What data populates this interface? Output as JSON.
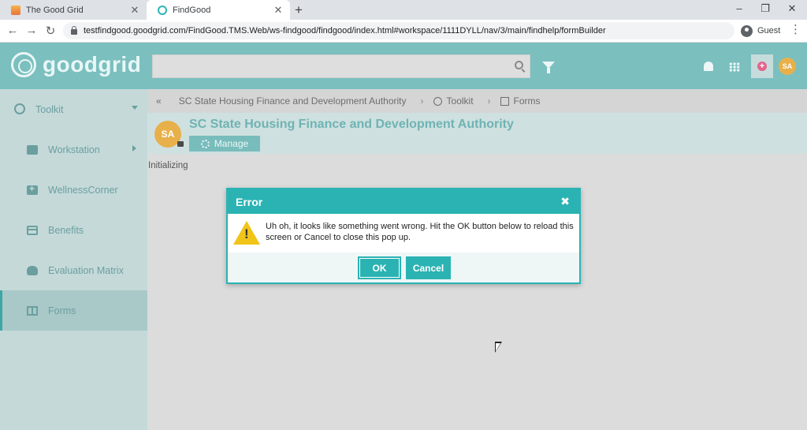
{
  "browser": {
    "tabs": [
      {
        "title": "The Good Grid",
        "active": false
      },
      {
        "title": "FindGood",
        "active": true
      }
    ],
    "new_tab": "+",
    "url": "testfindgood.goodgrid.com/FindGood.TMS.Web/ws-findgood/findgood/index.html#workspace/1111DYLL/nav/3/main/findhelp/formBuilder",
    "profile": "Guest",
    "controls": {
      "minimize": "–",
      "restore": "❐",
      "close": "✕",
      "back": "←",
      "forward": "→",
      "reload": "↻",
      "menu": "⋮"
    }
  },
  "header": {
    "logo_text": "goodgrid",
    "search_placeholder": "",
    "user_initials": "SA",
    "plus_symbol": "+"
  },
  "sidebar": {
    "items": [
      {
        "label": "Toolkit",
        "icon": "globe-icon",
        "arrow": "down"
      },
      {
        "label": "Workstation",
        "icon": "briefcase-icon",
        "arrow": "right"
      },
      {
        "label": "WellnessCorner",
        "icon": "medkit-icon"
      },
      {
        "label": "Benefits",
        "icon": "credit-card-icon"
      },
      {
        "label": "Evaluation Matrix",
        "icon": "cloud-upload-icon"
      },
      {
        "label": "Forms",
        "icon": "columns-icon",
        "active": true
      }
    ]
  },
  "breadcrumb": {
    "collapse": "«",
    "items": [
      "SC State Housing Finance and Development Authority",
      "Toolkit",
      "Forms"
    ],
    "separator": "›"
  },
  "org": {
    "initials": "SA",
    "title": "SC State Housing Finance and Development Authority",
    "manage_label": "Manage"
  },
  "status_text": "Initializing",
  "modal": {
    "title": "Error",
    "close": "✖",
    "message": "Uh oh, it looks like something went wrong. Hit the OK button below to reload this screen or Cancel to close this pop up.",
    "ok_label": "OK",
    "cancel_label": "Cancel"
  },
  "colors": {
    "accent": "#2bb3b3",
    "header": "#7bbfbf",
    "sidebar": "#c5d9d9",
    "avatar": "#e8b04a",
    "warning": "#f0c419"
  }
}
